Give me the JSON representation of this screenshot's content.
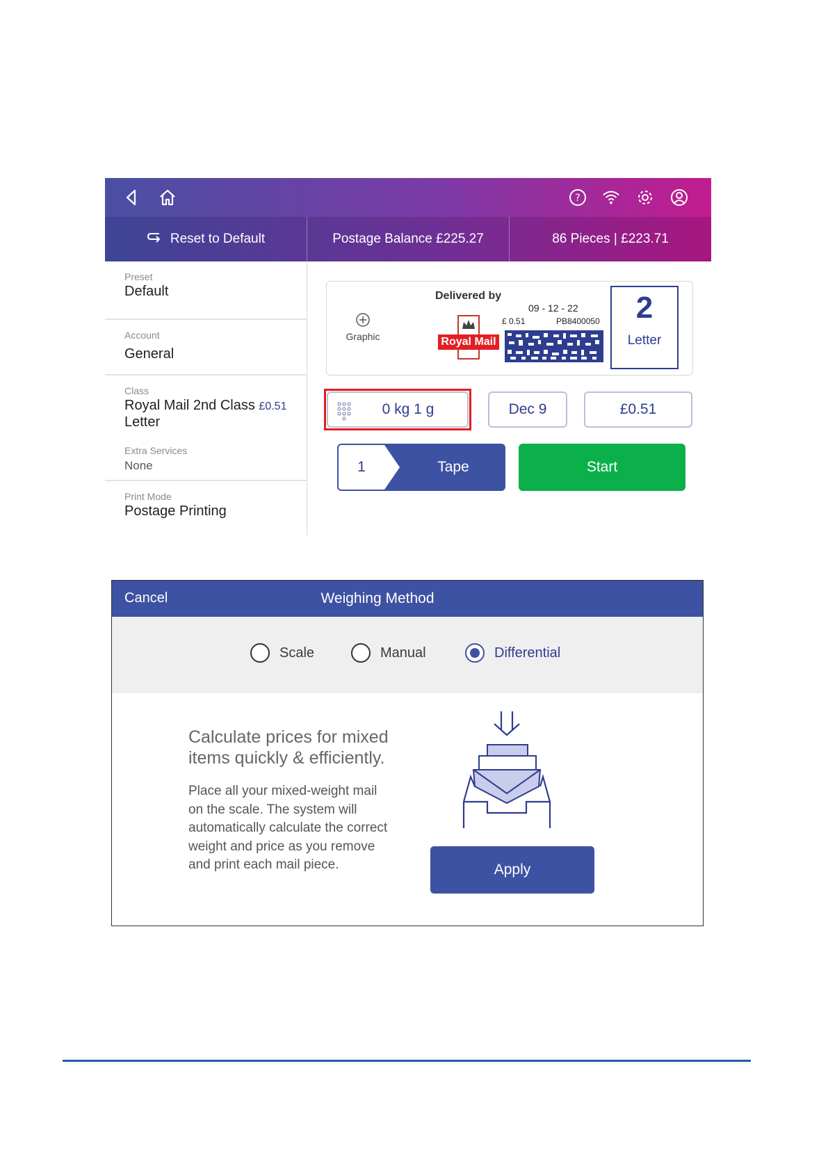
{
  "header": {
    "reset_label": "Reset to Default",
    "balance_label": "Postage Balance £225.27",
    "pieces_label": "86 Pieces | £223.71"
  },
  "icons": {
    "back": "back-arrow-icon",
    "home": "home-icon",
    "help": "help-icon",
    "wifi": "wifi-icon",
    "settings": "gear-icon",
    "account": "user-icon"
  },
  "settings": {
    "preset_label": "Preset",
    "preset_value": "Default",
    "account_label": "Account",
    "account_value": "General",
    "class_label": "Class",
    "class_value": "Royal Mail 2nd Class",
    "class_price": "£0.51",
    "class_value_line2": "Letter",
    "extra_label": "Extra Services",
    "extra_value": "None",
    "printmode_label": "Print Mode",
    "printmode_value": "Postage Printing"
  },
  "preview": {
    "graphic_label": "Graphic",
    "delivered_by": "Delivered by",
    "brand": "Royal Mail",
    "date": "09 - 12 - 22",
    "amount": "£ 0.51",
    "code": "PB8400050",
    "class_number": "2",
    "class_type": "Letter"
  },
  "controls": {
    "weight": "0 kg 1 g",
    "date": "Dec 9",
    "price": "£0.51",
    "tape_count": "1",
    "tape_label": "Tape",
    "start_label": "Start"
  },
  "dialog": {
    "cancel_label": "Cancel",
    "title": "Weighing Method",
    "options": [
      "Scale",
      "Manual",
      "Differential"
    ],
    "selected": "Differential",
    "heading_line1": "Calculate prices for mixed",
    "heading_line2": "items quickly & efficiently.",
    "body_lines": [
      "Place all your mixed-weight mail",
      "on the scale. The system will",
      "automatically calculate the correct",
      "weight and price as you remove",
      "and print each mail piece."
    ],
    "apply_label": "Apply"
  },
  "colors": {
    "accent_blue": "#3d52a3",
    "start_green": "#0bb04b",
    "highlight_red": "#e31e24"
  }
}
